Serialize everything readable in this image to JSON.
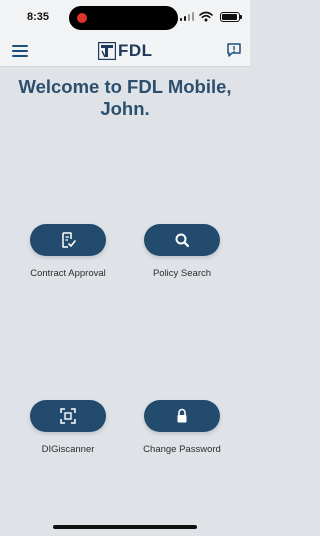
{
  "status_bar": {
    "time": "8:35",
    "battery_level": 0.95
  },
  "header": {
    "logo_text": "FDL"
  },
  "welcome": {
    "line1": "Welcome to FDL Mobile,",
    "line2": "John."
  },
  "actions": [
    {
      "label": "Contract Approval",
      "icon": "document-check-icon"
    },
    {
      "label": "Policy Search",
      "icon": "search-icon"
    },
    {
      "label": "DIGiscanner",
      "icon": "scan-icon"
    },
    {
      "label": "Change Password",
      "icon": "lock-icon"
    }
  ],
  "colors": {
    "accent": "#234b6d",
    "title": "#2c4f6e",
    "background": "#dfe3e8",
    "bar": "#f2f3f5",
    "recording_dot": "#e0342b"
  }
}
